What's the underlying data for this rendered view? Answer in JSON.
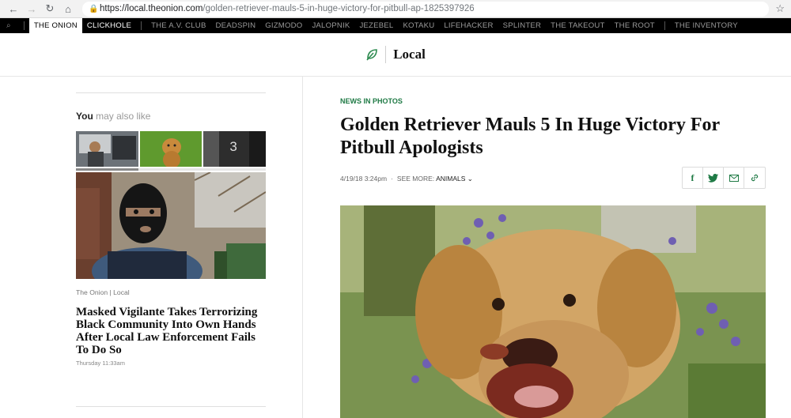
{
  "browser": {
    "url_host": "https://local.theonion.com",
    "url_path": "/golden-retriever-mauls-5-in-huge-victory-for-pitbull-ap-1825397926"
  },
  "network_bar": {
    "items": [
      "THE ONION",
      "CLICKHOLE",
      "THE A.V. CLUB",
      "DEADSPIN",
      "GIZMODO",
      "JALOPNIK",
      "JEZEBEL",
      "KOTAKU",
      "LIFEHACKER",
      "SPLINTER",
      "THE TAKEOUT",
      "THE ROOT",
      "THE INVENTORY"
    ]
  },
  "site": {
    "section_name": "Local",
    "brand_color": "#1f7a45"
  },
  "sidebar": {
    "may_like_bold": "You",
    "may_like_rest": "may also like",
    "thumb_number": "3",
    "carousel_progress": 0.33,
    "source": "The Onion | Local",
    "title": "Masked Vigilante Takes Terrorizing Black Community Into Own Hands After Local Law Enforcement Fails To Do So",
    "time": "Thursday 11:33am"
  },
  "article": {
    "kicker": "News in Photos",
    "headline": "Golden Retriever Mauls 5 In Huge Victory For Pitbull Apologists",
    "timestamp": "4/19/18 3:24pm",
    "see_more": "See More:",
    "category": "Animals",
    "share": [
      "facebook-icon",
      "twitter-icon",
      "email-icon",
      "link-icon"
    ]
  }
}
